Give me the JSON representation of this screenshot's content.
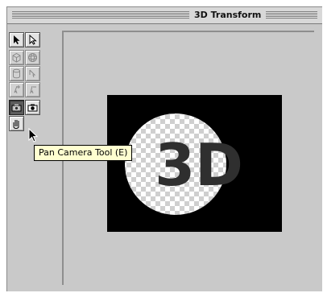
{
  "window": {
    "title": "3D Transform"
  },
  "toolbox": {
    "tools": [
      {
        "name": "selection-tool",
        "icon": "arrow-icon"
      },
      {
        "name": "direct-selection-tool",
        "icon": "hollow-arrow-icon"
      },
      {
        "name": "cube-tool",
        "icon": "cube-icon"
      },
      {
        "name": "sphere-tool",
        "icon": "sphere-icon"
      },
      {
        "name": "cylinder-tool",
        "icon": "cylinder-icon"
      },
      {
        "name": "convert-point-tool",
        "icon": "convert-point-icon"
      },
      {
        "name": "add-anchor-point-tool",
        "icon": "add-point-icon"
      },
      {
        "name": "delete-anchor-point-tool",
        "icon": "delete-point-icon"
      },
      {
        "name": "pan-camera-tool",
        "icon": "pan-camera-icon",
        "active": true
      },
      {
        "name": "trackball-tool",
        "icon": "trackball-icon"
      },
      {
        "name": "hand-tool",
        "icon": "hand-icon"
      }
    ]
  },
  "tooltip": {
    "text": "Pan Camera Tool (E)"
  },
  "preview": {
    "label": "3D",
    "pattern": "transparency-checkerboard"
  }
}
